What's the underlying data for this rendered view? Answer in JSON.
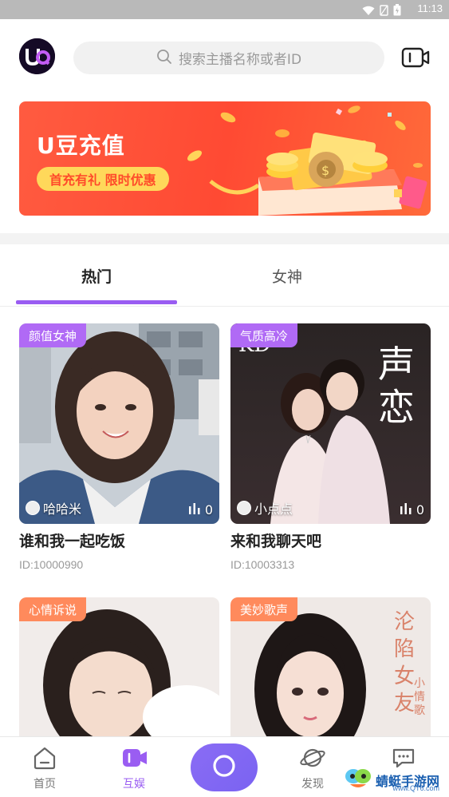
{
  "status_bar": {
    "time": "11:13",
    "icons": [
      "wifi-icon",
      "sim-icon",
      "battery-icon"
    ]
  },
  "header": {
    "logo_text": "UQ",
    "search_placeholder": "搜索主播名称或者ID",
    "camera_icon": "camera-icon"
  },
  "banner": {
    "title": "U豆充值",
    "subtitle": "首充有礼 限时优惠"
  },
  "tabs": [
    {
      "label": "热门",
      "active": true
    },
    {
      "label": "女神",
      "active": false
    }
  ],
  "cards": [
    {
      "tag": "颜值女神",
      "tag_color": "#b06af5",
      "host": "哈哈米",
      "count": "0",
      "title": "谁和我一起吃饭",
      "id": "ID:10000990"
    },
    {
      "tag": "气质高冷",
      "tag_color": "#b06af5",
      "host": "小点点",
      "count": "0",
      "title": "来和我聊天吧",
      "id": "ID:10003313",
      "overlay_text": "声恋",
      "overlay_small": "KD"
    },
    {
      "tag": "心情诉说",
      "tag_color": "#ff8a5c",
      "title": "",
      "id": ""
    },
    {
      "tag": "美妙歌声",
      "tag_color": "#ff8a5c",
      "title": "",
      "id": "",
      "overlay_text": "沦陷女友",
      "overlay_small": "小情歌"
    }
  ],
  "bottom_nav": [
    {
      "label": "首页",
      "icon": "home-icon",
      "active": false
    },
    {
      "label": "互娱",
      "icon": "live-icon",
      "active": true
    },
    {
      "label": "",
      "icon": "record-icon",
      "active": false
    },
    {
      "label": "发现",
      "icon": "planet-icon",
      "active": false
    },
    {
      "label": "",
      "icon": "message-icon",
      "active": false
    }
  ],
  "watermark": {
    "text": "蜻蜓手游网",
    "url": "www.QT6.com"
  },
  "colors": {
    "accent": "#9a5df2",
    "banner": "#ff4a33",
    "pill": "#ffd85a"
  }
}
